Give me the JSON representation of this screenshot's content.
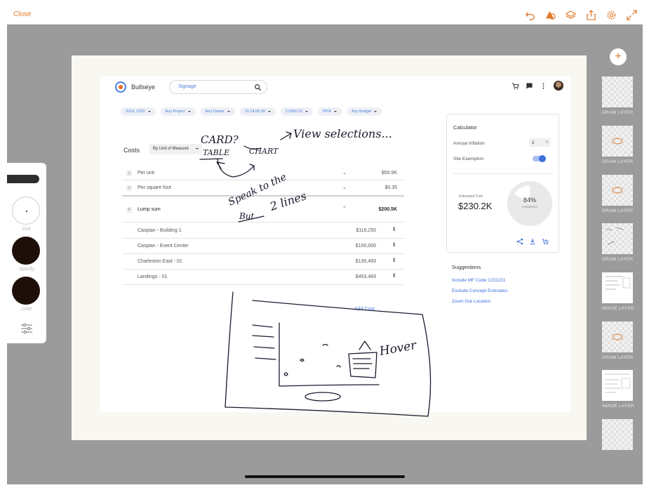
{
  "toolbar": {
    "close_label": "Close",
    "icons": [
      "undo-icon",
      "shapes-icon",
      "layers-icon",
      "share-icon",
      "settings-icon",
      "fullscreen-icon"
    ],
    "accent_color": "#e07a2c"
  },
  "tool_panel": {
    "size_label": "size",
    "opacity_label": "opacity",
    "color_label": "color",
    "brush_color": "#1e0f09"
  },
  "layers": [
    {
      "label": "DRAW LAYER",
      "kind": "draw"
    },
    {
      "label": "DRAW LAYER",
      "kind": "draw"
    },
    {
      "label": "DRAW LAYER",
      "kind": "draw"
    },
    {
      "label": "DRAW LAYER",
      "kind": "draw"
    },
    {
      "label": "IMAGE LAYER",
      "kind": "image"
    },
    {
      "label": "DRAW LAYER",
      "kind": "draw"
    },
    {
      "label": "IMAGE LAYER",
      "kind": "image"
    },
    {
      "label": "",
      "kind": "draw"
    }
  ],
  "mock": {
    "brand": "Bullseye",
    "search_placeholder": "Signage",
    "filters": [
      "2019, 2020",
      "Any Project",
      "Any Owner",
      "10.14.00.00",
      "C1090.20",
      "INTA",
      "Any Budget"
    ],
    "costs_title": "Costs",
    "unit_select": "By Unit of Measure",
    "rows": [
      {
        "num": "1",
        "label": "Per unit",
        "value": "$50.9K"
      },
      {
        "num": "1",
        "label": "Per square foot",
        "value": "$0.35"
      },
      {
        "num": "4",
        "label": "Lump sum",
        "value": "$200.5K"
      }
    ],
    "sub_rows": [
      {
        "label": "Caspian - Building 1",
        "value": "$118,250"
      },
      {
        "label": "Caspian - Event Center",
        "value": "$100,000"
      },
      {
        "label": "Charleston East - 01",
        "value": "$130,493"
      },
      {
        "label": "Landings - 01",
        "value": "$453,483"
      }
    ],
    "add_cost": "Add Cost",
    "calculator": {
      "title": "Calculator",
      "inflation_label": "Annual Inflation",
      "inflation_value": "2",
      "inflation_unit": "%",
      "exemption_label": "Site Exemption",
      "exemption_on": true,
      "estimated_label": "Estimated Cost",
      "estimated_value": "$230.2K",
      "confidence_pct": "84%",
      "confidence_label": "confidence",
      "confidence_fraction": 0.84
    },
    "suggestions_title": "Suggestions",
    "suggestions": [
      "Include MF Code 1231231",
      "Exclude Concept Estimates",
      "Zoom Out Location"
    ]
  },
  "annotations": {
    "card": "CARD?",
    "table": "TABLE",
    "chart": "CHART",
    "view_selections": "View selections...",
    "speak": "Speak to the",
    "but": "But",
    "lines": "2 lines",
    "hover": "Hover",
    "ink_color": "#1a1a2e"
  }
}
